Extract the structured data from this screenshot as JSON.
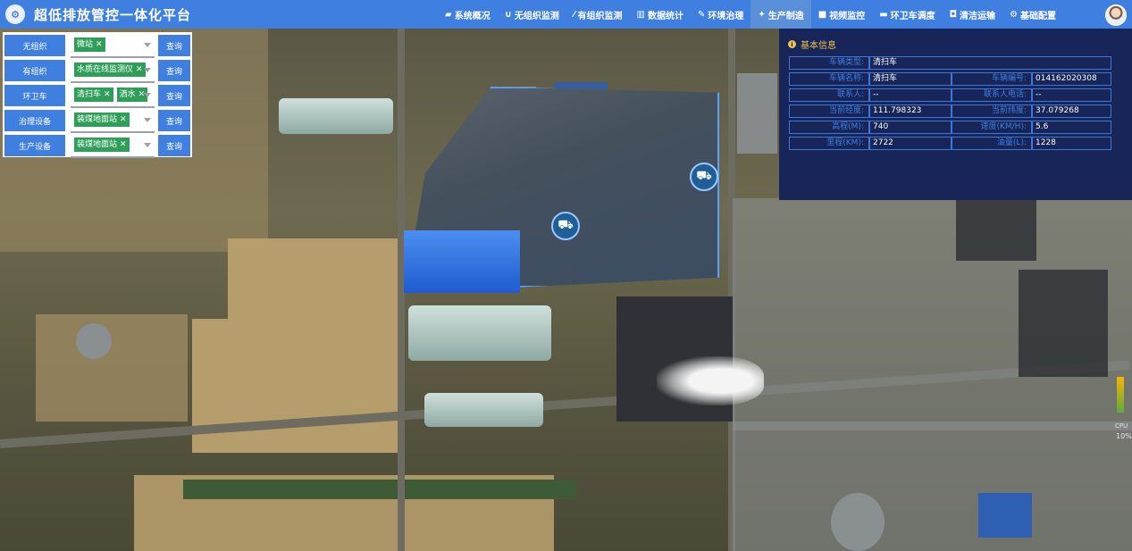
{
  "header": {
    "logo_text": "⚙",
    "title": "超低排放管控一体化平台",
    "nav": [
      {
        "label": "系统概况",
        "icon": "map-icon",
        "glyph": "▰"
      },
      {
        "label": "无组织监测",
        "icon": "magnet-icon",
        "glyph": "∪"
      },
      {
        "label": "有组织监测",
        "icon": "wand-icon",
        "glyph": "⁄"
      },
      {
        "label": "数据统计",
        "icon": "bar-chart-icon",
        "glyph": "▥"
      },
      {
        "label": "环境治理",
        "icon": "leaf-icon",
        "glyph": "✎"
      },
      {
        "label": "生产制造",
        "icon": "wrench-icon",
        "glyph": "✦"
      },
      {
        "label": "视频监控",
        "icon": "video-camera-icon",
        "glyph": "■"
      },
      {
        "label": "环卫车调度",
        "icon": "truck-icon",
        "glyph": "▬"
      },
      {
        "label": "清洁运输",
        "icon": "bus-icon",
        "glyph": "◘"
      },
      {
        "label": "基础配置",
        "icon": "cogs-icon",
        "glyph": "⚙"
      }
    ]
  },
  "filters": [
    {
      "label": "无组织",
      "tags": [
        "微站"
      ],
      "query": "查询"
    },
    {
      "label": "有组织",
      "tags": [
        "水质在线监测仪"
      ],
      "query": "查询"
    },
    {
      "label": "环卫车",
      "tags": [
        "清扫车",
        "洒水"
      ],
      "query": "查询"
    },
    {
      "label": "治理设备",
      "tags": [
        "装煤地面站"
      ],
      "query": "查询"
    },
    {
      "label": "生产设备",
      "tags": [
        "装煤地面站"
      ],
      "query": "查询"
    }
  ],
  "info": {
    "title": "基本信息",
    "rows": [
      [
        {
          "k": "车辆类型:",
          "v": "清扫车"
        }
      ],
      [
        {
          "k": "车辆名称:",
          "v": "清扫车"
        },
        {
          "k": "车辆编号:",
          "v": "014162020308"
        }
      ],
      [
        {
          "k": "联系人:",
          "v": "--"
        },
        {
          "k": "联系人电话:",
          "v": "--"
        }
      ],
      [
        {
          "k": "当前经度:",
          "v": "111.798323"
        },
        {
          "k": "当前纬度:",
          "v": "37.079268"
        }
      ],
      [
        {
          "k": "高程(M):",
          "v": "740"
        },
        {
          "k": "速度(KM/H):",
          "v": "5.6"
        }
      ],
      [
        {
          "k": "里程(KM):",
          "v": "2722"
        },
        {
          "k": "油量(L):",
          "v": "1228"
        }
      ]
    ]
  },
  "map": {
    "cpu_label": "CPU",
    "cpu_value": "10%"
  },
  "colors": {
    "header_bg": "#3f7fe0",
    "panel_bg": "#172559",
    "tag_bg": "#2f9e59",
    "accent": "#f0c44c"
  }
}
